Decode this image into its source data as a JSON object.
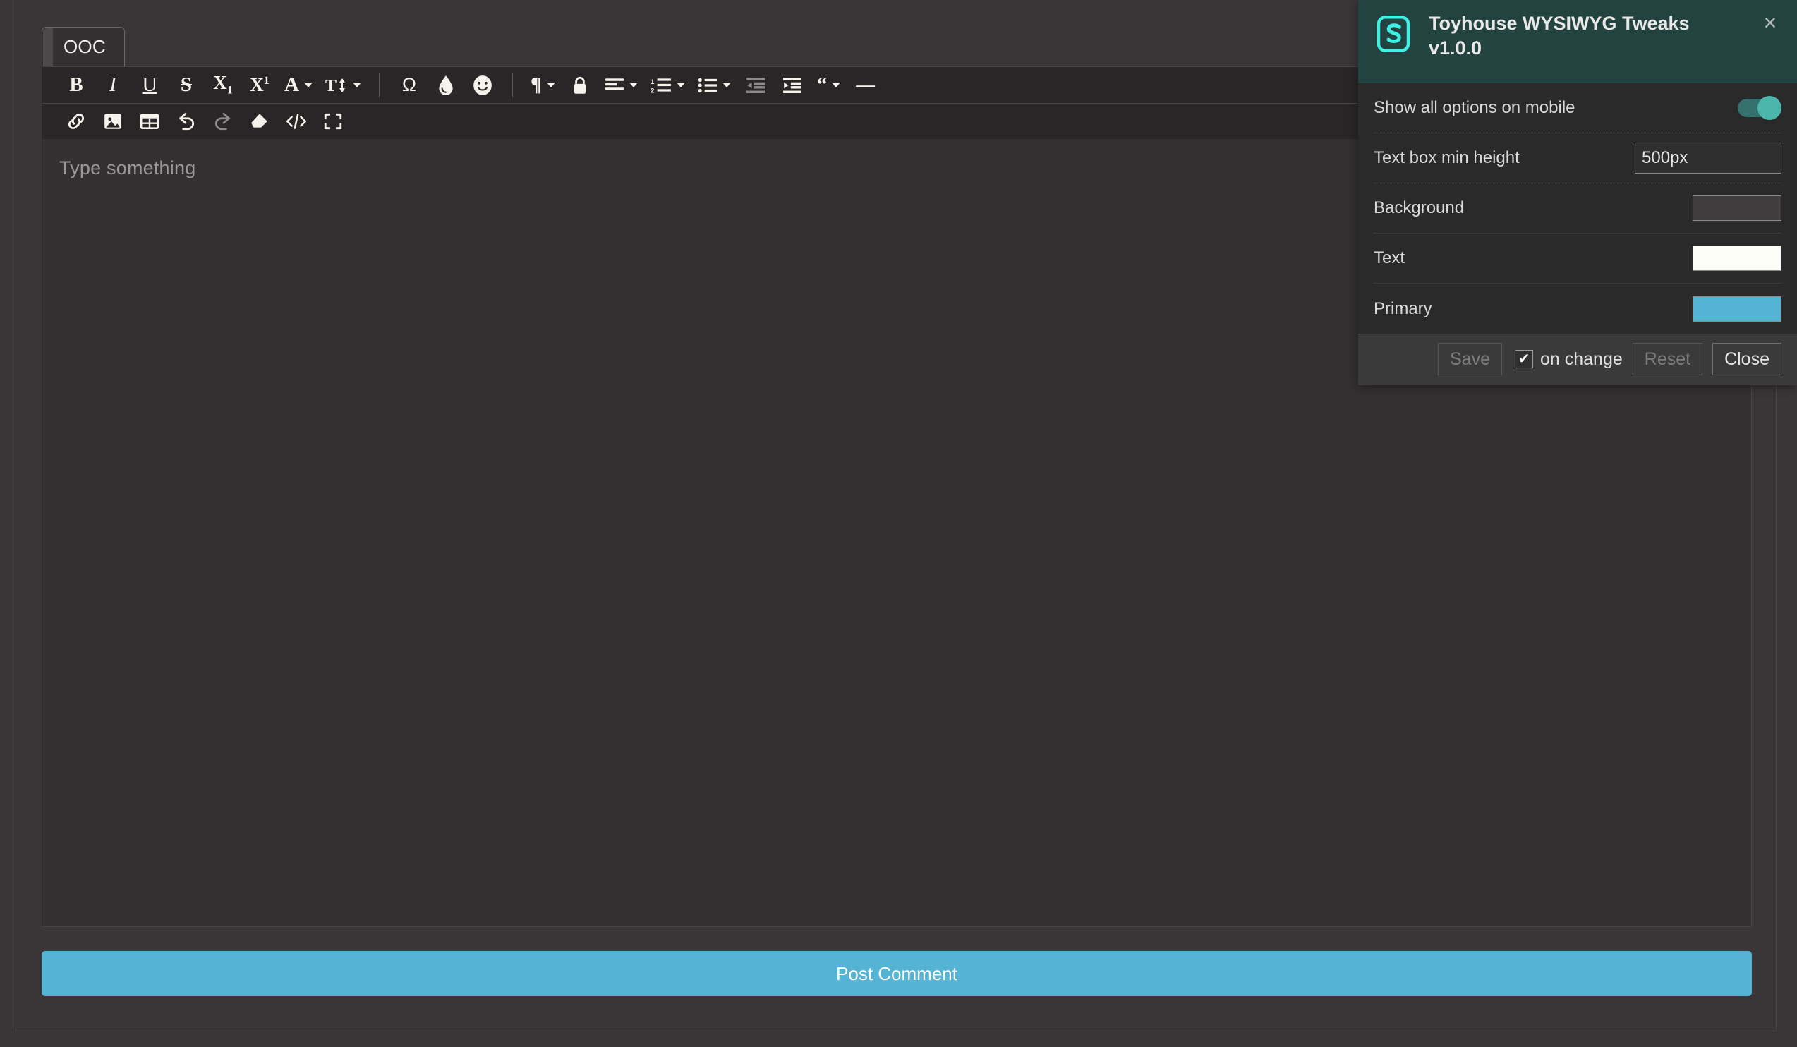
{
  "editor": {
    "tab_label": "OOC",
    "placeholder": "Type something",
    "post_button_label": "Post Comment",
    "toolbar_row_1": [
      {
        "name": "bold-button",
        "label": "B"
      },
      {
        "name": "italic-button",
        "label": "I"
      },
      {
        "name": "underline-button",
        "label": "U"
      },
      {
        "name": "strikethrough-button",
        "label": "S"
      },
      {
        "name": "subscript-button",
        "label": "X"
      },
      {
        "name": "superscript-button",
        "label": "X"
      },
      {
        "name": "font-family-button",
        "label": "A"
      },
      {
        "name": "font-size-button",
        "label": "T"
      },
      {
        "name": "special-character-button",
        "label": "Ω"
      },
      {
        "name": "text-color-button",
        "label": "droplet"
      },
      {
        "name": "emoji-button",
        "label": "smiley"
      },
      {
        "name": "paragraph-format-button",
        "label": "¶"
      },
      {
        "name": "lock-button",
        "label": "lock"
      },
      {
        "name": "align-button",
        "label": "align"
      },
      {
        "name": "ordered-list-button",
        "label": "ordered-list"
      },
      {
        "name": "unordered-list-button",
        "label": "unordered-list"
      },
      {
        "name": "outdent-button",
        "label": "outdent"
      },
      {
        "name": "indent-button",
        "label": "indent"
      },
      {
        "name": "blockquote-button",
        "label": "“"
      },
      {
        "name": "horizontal-rule-button",
        "label": "—"
      }
    ],
    "toolbar_row_2": [
      {
        "name": "insert-link-button",
        "label": "link"
      },
      {
        "name": "insert-image-button",
        "label": "image"
      },
      {
        "name": "insert-table-button",
        "label": "table"
      },
      {
        "name": "undo-button",
        "label": "undo"
      },
      {
        "name": "redo-button",
        "label": "redo"
      },
      {
        "name": "clear-formatting-button",
        "label": "eraser"
      },
      {
        "name": "code-view-button",
        "label": "</>"
      },
      {
        "name": "fullscreen-button",
        "label": "fullscreen"
      }
    ]
  },
  "settings": {
    "title": "Toyhouse WYSIWYG Tweaks v1.0.0",
    "close_icon": "×",
    "logo_icon": "stylus-s-logo",
    "rows": [
      {
        "label": "Show all options on mobile",
        "type": "toggle",
        "value": "on"
      },
      {
        "label": "Text box min height",
        "type": "text",
        "value": "500px"
      },
      {
        "label": "Background",
        "type": "color",
        "value": "#413d3e"
      },
      {
        "label": "Text",
        "type": "color",
        "value": "#fdfdf8"
      },
      {
        "label": "Primary",
        "type": "color",
        "value": "#55b4d4"
      }
    ],
    "footer": {
      "save_label": "Save",
      "on_change_label": "on change",
      "on_change_checked": "✔",
      "reset_label": "Reset",
      "close_label": "Close"
    }
  },
  "colors": {
    "primary": "#55b4d4",
    "panel_header": "#234340",
    "logo_cyan": "#3ff0e4",
    "toggle_on": "#4db6ac"
  }
}
